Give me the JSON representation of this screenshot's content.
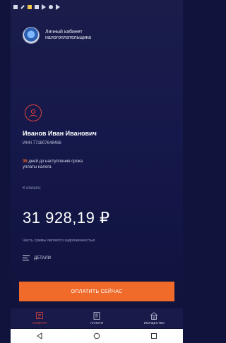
{
  "header": {
    "line1": "Личный кабинет",
    "line2": "налогоплательщика"
  },
  "user": {
    "name": "Иванов Иван Иванович",
    "inn": "ИНН 771807648466"
  },
  "deadline": {
    "days": "35",
    "text": " дней до наступления срока",
    "text2": "уплаты налога"
  },
  "payment": {
    "label": "К оплате:",
    "amount": "31 928,19 ₽",
    "note": "Часть суммы является задолженностью",
    "details_label": "ДЕТАЛИ",
    "pay_button": "ОПЛАТИТЬ СЕЙЧАС"
  },
  "tabs": [
    {
      "label": "ГЛАВНАЯ",
      "icon": "home-icon",
      "active": true
    },
    {
      "label": "НАЛОГИ",
      "icon": "taxes-icon",
      "active": false
    },
    {
      "label": "ИМУЩЕСТВО",
      "icon": "property-icon",
      "active": false
    }
  ],
  "colors": {
    "accent": "#f06a2a",
    "active_tab": "#e0423e",
    "background": "#15184a"
  }
}
